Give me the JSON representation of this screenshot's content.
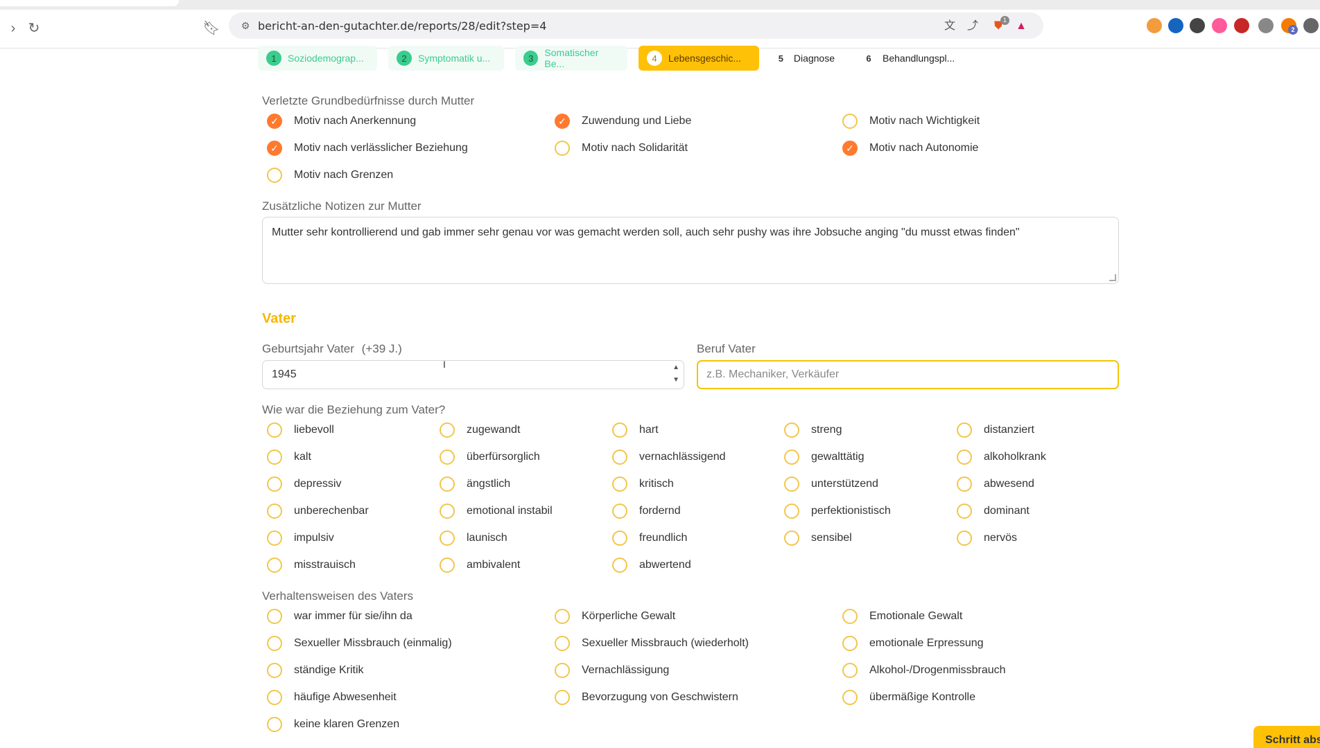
{
  "browser": {
    "url": "bericht-an-den-gutachter.de/reports/28/edit?step=4",
    "extensions": [
      {
        "name": "extension-icon-orange",
        "color": "#f39c3d",
        "badge": ""
      },
      {
        "name": "extension-icon-blue",
        "color": "#1565c0",
        "badge": ""
      },
      {
        "name": "extension-icon-dark",
        "color": "#444444",
        "badge": ""
      },
      {
        "name": "extension-icon-pink",
        "color": "#ff5a9a",
        "badge": ""
      },
      {
        "name": "extension-icon-red",
        "color": "#c62828",
        "badge": ""
      },
      {
        "name": "extension-icon-camera",
        "color": "#888888",
        "badge": ""
      },
      {
        "name": "extension-icon-badge",
        "color": "#f57c00",
        "badge": "2"
      },
      {
        "name": "extensions-puzzle-icon",
        "color": "#666666",
        "badge": ""
      }
    ],
    "shield_badge": "1"
  },
  "steps": [
    {
      "num": "1",
      "label": "Soziodemograp...",
      "state": "done"
    },
    {
      "num": "2",
      "label": "Symptomatik u...",
      "state": "done"
    },
    {
      "num": "3",
      "label": "Somatischer Be...",
      "state": "done"
    },
    {
      "num": "4",
      "label": "Lebensgeschic...",
      "state": "active"
    },
    {
      "num": "5",
      "label": "Diagnose",
      "state": "todo"
    },
    {
      "num": "6",
      "label": "Behandlungspl...",
      "state": "todo"
    }
  ],
  "mother": {
    "needs_title": "Verletzte Grundbedürfnisse durch Mutter",
    "needs": [
      {
        "label": "Motiv nach Anerkennung",
        "checked": true
      },
      {
        "label": "Zuwendung und Liebe",
        "checked": true
      },
      {
        "label": "Motiv nach Wichtigkeit",
        "checked": false
      },
      {
        "label": "Motiv nach verlässlicher Beziehung",
        "checked": true
      },
      {
        "label": "Motiv nach Solidarität",
        "checked": false
      },
      {
        "label": "Motiv nach Autonomie",
        "checked": true
      },
      {
        "label": "Motiv nach Grenzen",
        "checked": false
      }
    ],
    "notes_label": "Zusätzliche Notizen zur Mutter",
    "notes_value": "Mutter sehr kontrollierend und gab immer sehr genau vor was gemacht werden soll, auch sehr pushy was ihre Jobsuche anging \"du musst etwas finden\""
  },
  "father": {
    "heading": "Vater",
    "birth_year_label": "Geburtsjahr Vater",
    "age_hint": "(+39 J.)",
    "birth_year_value": "1945",
    "job_label": "Beruf Vater",
    "job_placeholder": "z.B. Mechaniker, Verkäufer",
    "relation_title": "Wie war die Beziehung zum Vater?",
    "relations": [
      "liebevoll",
      "zugewandt",
      "hart",
      "streng",
      "distanziert",
      "kalt",
      "überfürsorglich",
      "vernachlässigend",
      "gewalttätig",
      "alkoholkrank",
      "depressiv",
      "ängstlich",
      "kritisch",
      "unterstützend",
      "abwesend",
      "unberechenbar",
      "emotional instabil",
      "fordernd",
      "perfektionistisch",
      "dominant",
      "impulsiv",
      "launisch",
      "freundlich",
      "sensibel",
      "nervös",
      "misstrauisch",
      "ambivalent",
      "abwertend"
    ],
    "behaviors_title": "Verhaltensweisen des Vaters",
    "behaviors": [
      "war immer für sie/ihn da",
      "Körperliche Gewalt",
      "Emotionale Gewalt",
      "Sexueller Missbrauch (einmalig)",
      "Sexueller Missbrauch (wiederholt)",
      "emotionale Erpressung",
      "ständige Kritik",
      "Vernachlässigung",
      "Alkohol-/Drogenmissbrauch",
      "häufige Abwesenheit",
      "Bevorzugung von Geschwistern",
      "übermäßige Kontrolle",
      "keine klaren Grenzen"
    ]
  },
  "next_button_label": "Schritt abschließen",
  "colors": {
    "accent": "#ffc107",
    "checked": "#ff7a2e",
    "done": "#3bcc8e",
    "heading": "#f5b700"
  }
}
